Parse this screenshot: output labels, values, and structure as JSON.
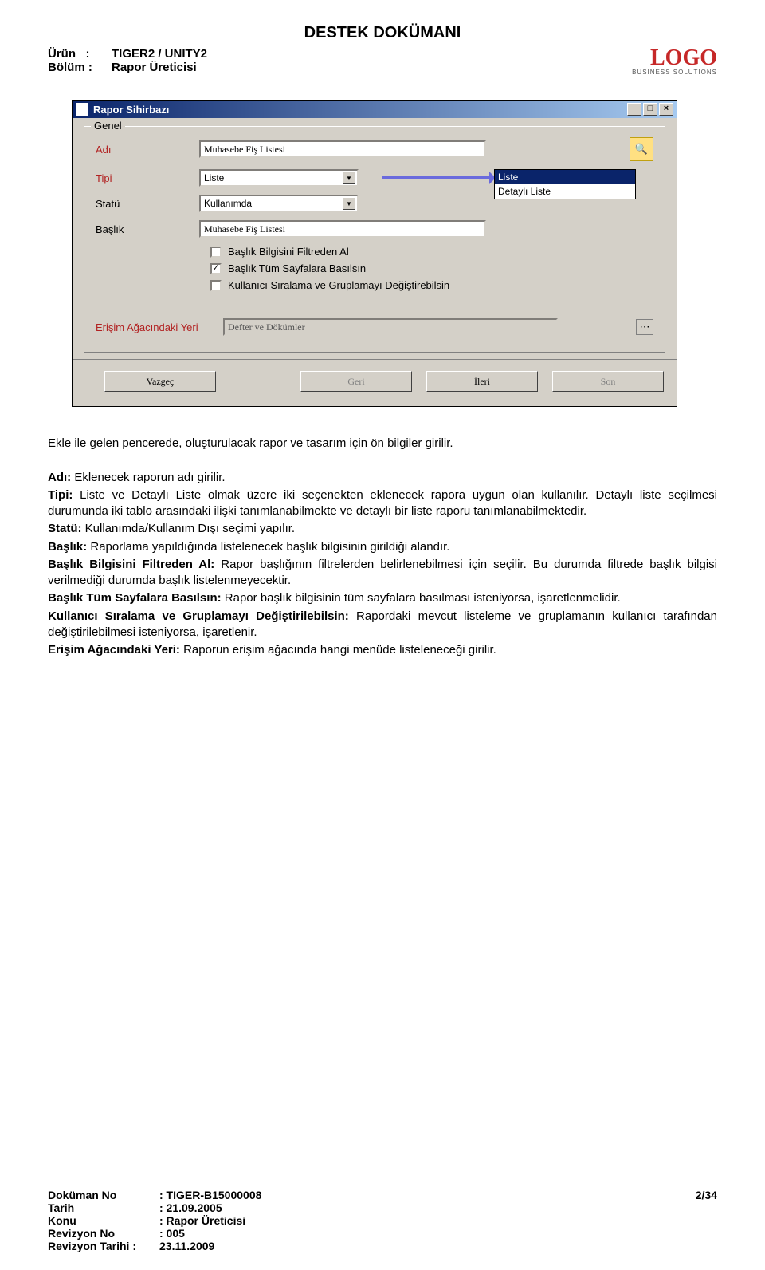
{
  "doc": {
    "title": "DESTEK DOKÜMANI",
    "product_label": "Ürün",
    "product_value": "TIGER2 / UNITY2",
    "section_label": "Bölüm :",
    "section_value": "Rapor Üreticisi",
    "logo_text": "LOGO",
    "logo_sub": "BUSINESS SOLUTIONS"
  },
  "window": {
    "title": "Rapor Sihirbazı",
    "group_legend": "Genel",
    "labels": {
      "adi": "Adı",
      "tipi": "Tipi",
      "statu": "Statü",
      "baslik": "Başlık",
      "erisim": "Erişim Ağacındaki Yeri"
    },
    "values": {
      "adi": "Muhasebe Fiş Listesi",
      "tipi": "Liste",
      "statu": "Kullanımda",
      "baslik": "Muhasebe Fiş Listesi",
      "erisim": "Defter ve Dökümler"
    },
    "dropdown": {
      "opt1": "Liste",
      "opt2": "Detaylı Liste"
    },
    "checks": {
      "c1": "Başlık Bilgisini Filtreden Al",
      "c2": "Başlık Tüm Sayfalara Basılsın",
      "c3": "Kullanıcı Sıralama ve Gruplamayı Değiştirebilsin"
    },
    "buttons": {
      "vazgec": "Vazgeç",
      "geri": "Geri",
      "ileri": "İleri",
      "son": "Son"
    }
  },
  "body": {
    "intro": "Ekle ile gelen pencerede, oluşturulacak rapor ve tasarım için ön bilgiler girilir.",
    "adi_l": "Adı:",
    "adi_t": " Eklenecek raporun adı girilir.",
    "tipi_l": "Tipi:",
    "tipi_t": " Liste ve Detaylı Liste olmak üzere iki seçenekten eklenecek rapora uygun olan kullanılır. Detaylı liste seçilmesi durumunda iki tablo arasındaki ilişki tanımlanabilmekte ve detaylı bir liste raporu tanımlanabilmektedir.",
    "statu_l": "Statü:",
    "statu_t": " Kullanımda/Kullanım Dışı seçimi yapılır.",
    "baslik_l": "Başlık:",
    "baslik_t": " Raporlama yapıldığında listelenecek başlık bilgisinin girildiği alandır.",
    "bfa_l": "Başlık Bilgisini Filtreden Al:",
    "bfa_t": " Rapor başlığının filtrelerden belirlenebilmesi için seçilir. Bu durumda filtrede başlık bilgisi verilmediği durumda başlık listelenmeyecektir.",
    "btsb_l": "Başlık Tüm Sayfalara Basılsın:",
    "btsb_t": " Rapor başlık bilgisinin tüm sayfalara basılması isteniyorsa, işaretlenmelidir.",
    "ksg_l": "Kullanıcı Sıralama ve Gruplamayı Değiştirilebilsin:",
    "ksg_t": " Rapordaki mevcut listeleme ve gruplamanın kullanıcı tarafından değiştirilebilmesi isteniyorsa, işaretlenir.",
    "eay_l": "Erişim Ağacındaki Yeri:",
    "eay_t": " Raporun erişim ağacında hangi menüde listeleneceği girilir."
  },
  "footer": {
    "dokuman_no_l": "Doküman No",
    "dokuman_no_v": ": TIGER-B15000008",
    "tarih_l": "Tarih",
    "tarih_v": ": 21.09.2005",
    "konu_l": "Konu",
    "konu_v": ": Rapor Üreticisi",
    "rev_no_l": "Revizyon No",
    "rev_no_v": ":   005",
    "rev_tarih_l": "Revizyon Tarihi :",
    "rev_tarih_v": "  23.11.2009",
    "page": "2/34"
  }
}
